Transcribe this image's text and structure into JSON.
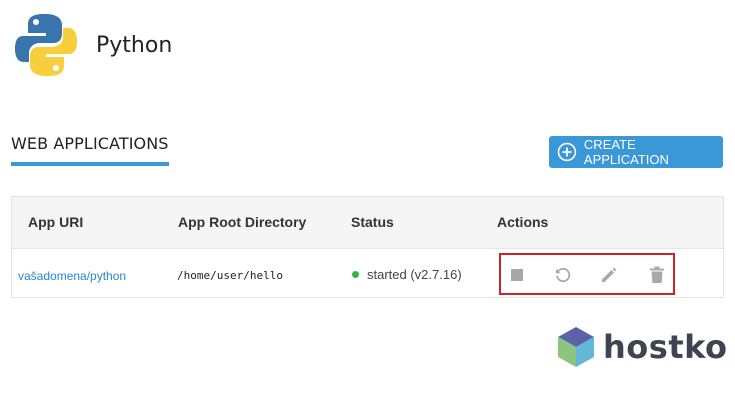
{
  "header": {
    "title": "Python",
    "logo_icon": "python-logo"
  },
  "section": {
    "tab_label": "WEB APPLICATIONS"
  },
  "toolbar": {
    "create_label": "CREATE APPLICATION",
    "create_icon": "plus-circle-icon"
  },
  "table": {
    "columns": [
      "App URI",
      "App Root Directory",
      "Status",
      "Actions"
    ],
    "rows": [
      {
        "uri": "vašadomena/python",
        "root_dir": "/home/user/hello",
        "status": "started (v2.7.16)",
        "actions": [
          "stop-icon",
          "restart-icon",
          "edit-icon",
          "trash-icon"
        ]
      }
    ]
  },
  "brand": {
    "name": "hostko"
  },
  "colors": {
    "accent": "#3a97d8",
    "status_ok": "#2fb548",
    "highlight": "#d0202a",
    "link": "#2b86cf"
  }
}
